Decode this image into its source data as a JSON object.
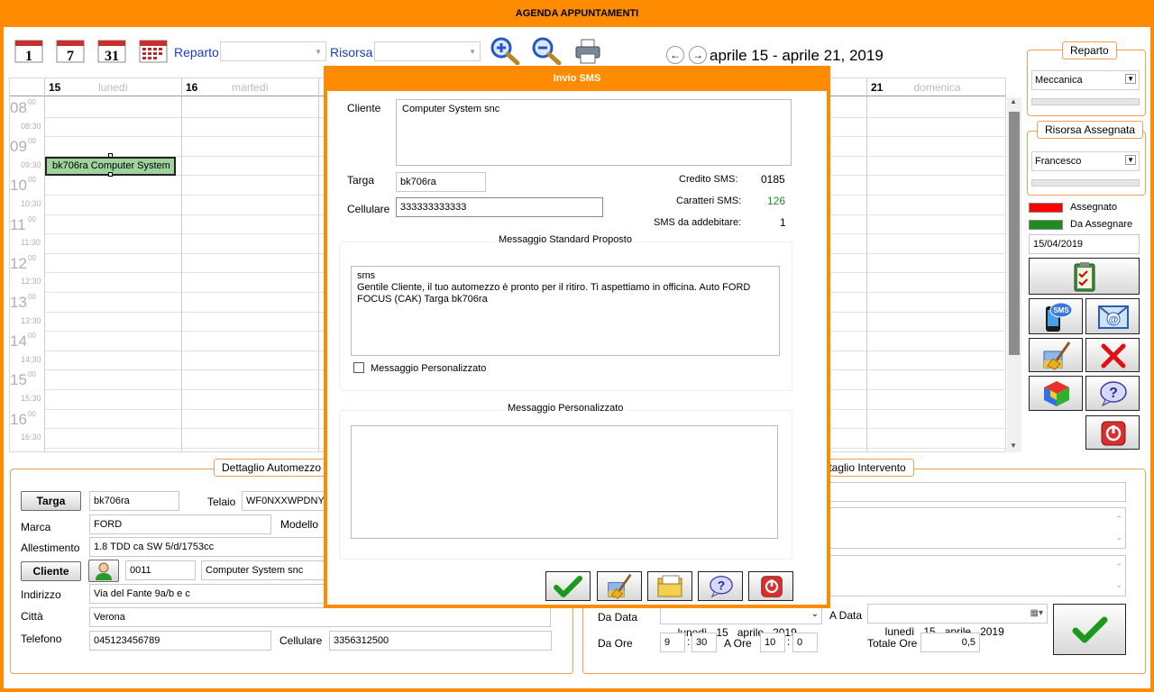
{
  "window": {
    "title": "AGENDA APPUNTAMENTI"
  },
  "toolbar": {
    "view_day_label": "1",
    "view_week_label": "7",
    "view_month_label": "31",
    "reparto_label": "Reparto",
    "risorsa_label": "Risorsa",
    "reparto_value": "",
    "risorsa_value": "",
    "week_range": "aprile 15 - aprile 21, 2019"
  },
  "calendar": {
    "days": [
      {
        "num": "15",
        "name": "lunedì"
      },
      {
        "num": "16",
        "name": "martedì"
      },
      {
        "num": "21",
        "name": "domenica"
      }
    ],
    "hours": [
      {
        "h": "08",
        "half": "08:30"
      },
      {
        "h": "09",
        "half": "09:30"
      },
      {
        "h": "10",
        "half": "10:30"
      },
      {
        "h": "11",
        "half": "11:30"
      },
      {
        "h": "12",
        "half": "12:30"
      },
      {
        "h": "13",
        "half": "13:30"
      },
      {
        "h": "14",
        "half": "14:30"
      },
      {
        "h": "15",
        "half": "15:30"
      },
      {
        "h": "16",
        "half": "16:30"
      }
    ],
    "minutes_sup": "00",
    "appointment": "bk706ra Computer System"
  },
  "sidebar": {
    "reparto_legend": "Reparto",
    "reparto_value": "Meccanica",
    "risorsa_legend": "Risorsa Assegnata",
    "risorsa_value": "Francesco",
    "legend_assegnato": "Assegnato",
    "legend_da_assegnare": "Da Assegnare",
    "date_value": "15/04/2019",
    "sms_badge": "SMS",
    "colors": {
      "assegnato": "#ff0000",
      "da_assegnare": "#1e8c1e"
    }
  },
  "automezzo": {
    "legend": "Dettaglio Automezzo",
    "targa_btn": "Targa",
    "targa_value": "bk706ra",
    "telaio_label": "Telaio",
    "telaio_value": "WF0NXXWPDNYF",
    "marca_label": "Marca",
    "marca_value": "FORD",
    "modello_label": "Modello",
    "allestimento_label": "Allestimento",
    "allestimento_value": "1.8 TDD ca SW 5/d/1753cc",
    "cliente_btn": "Cliente",
    "cliente_code": "0011",
    "cliente_name": "Computer System snc",
    "indirizzo_label": "Indirizzo",
    "indirizzo_value": "Via del Fante 9a/b e c",
    "citta_label": "Città",
    "citta_value": "Verona",
    "telefono_label": "Telefono",
    "telefono_value": "045123456789",
    "cellulare_label": "Cellulare",
    "cellulare_value": "3356312500"
  },
  "intervento": {
    "legend": "ttaglio Intervento",
    "da_data_label": "Da Data",
    "da_data_value": "lunedì   15   aprile   2019",
    "a_data_label": "A Data",
    "a_data_value": "lunedì   15   aprile   2019",
    "da_ore_label": "Da Ore",
    "da_ore_h": "9",
    "da_ore_m": "30",
    "a_ore_label": "A Ore",
    "a_ore_h": "10",
    "a_ore_m": "0",
    "colon": ":",
    "totale_label": "Totale Ore",
    "totale_value": "0,5"
  },
  "dialog": {
    "title": "Invio SMS",
    "cliente_label": "Cliente",
    "cliente_value": "Computer System snc",
    "targa_label": "Targa",
    "targa_value": "bk706ra",
    "cellulare_label": "Cellulare",
    "cellulare_value": "333333333333",
    "credito_label": "Credito SMS:",
    "credito_value": "0185",
    "caratteri_label": "Caratteri SMS:",
    "caratteri_value": "126",
    "addebitare_label": "SMS da addebitare:",
    "addebitare_value": "1",
    "standard_legend": "Messaggio Standard Proposto",
    "standard_text": "sms\nGentile Cliente, il tuo automezzo è pronto per il ritiro. Ti aspettiamo in officina. Auto FORD FOCUS (CAK) Targa bk706ra",
    "personalizzato_checkbox": "Messaggio  Personalizzato",
    "personalizzato_legend": "Messaggio  Personalizzato",
    "personalizzato_text": "",
    "caratteri_color": "#1e8c1e"
  }
}
